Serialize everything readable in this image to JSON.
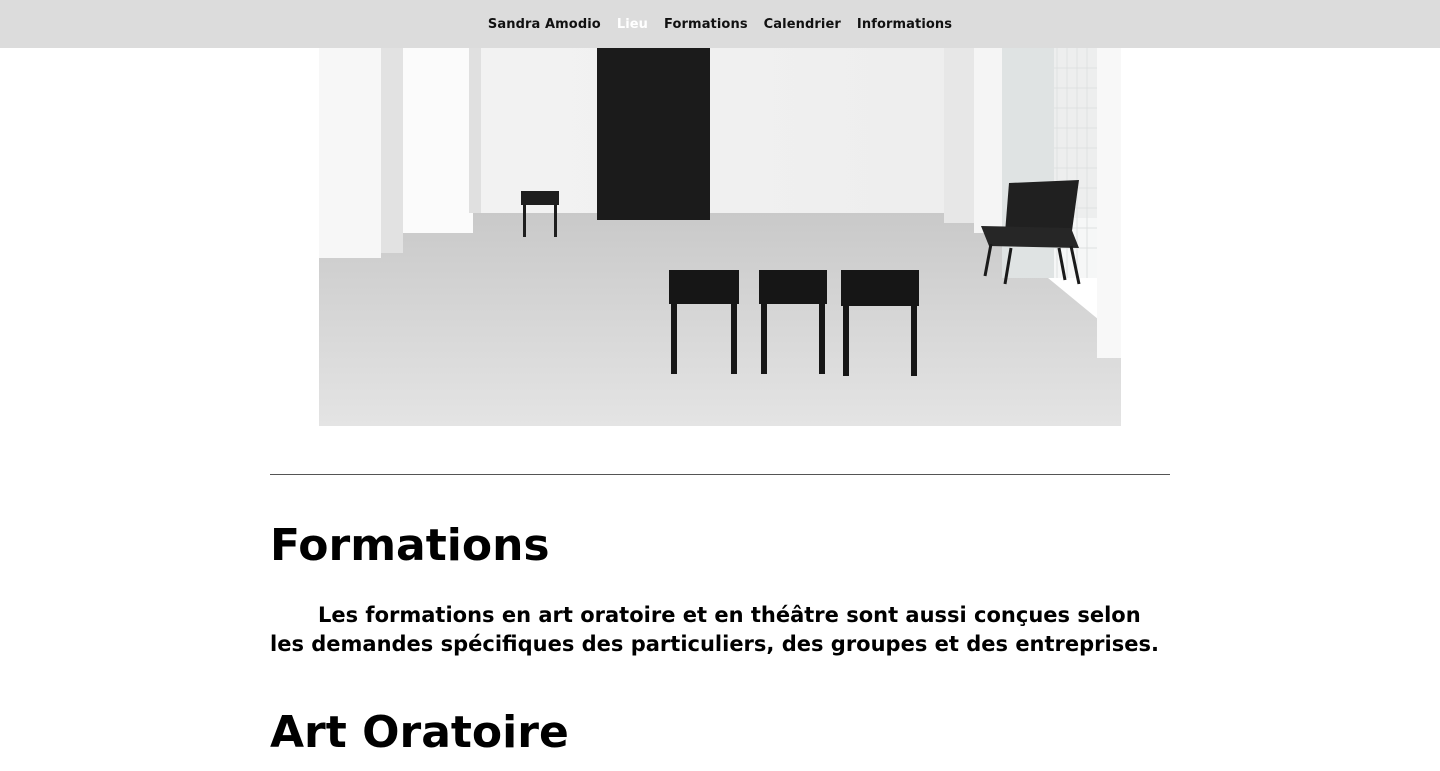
{
  "nav": {
    "items": [
      {
        "label": "Sandra Amodio",
        "active": false
      },
      {
        "label": "Lieu",
        "active": true
      },
      {
        "label": "Formations",
        "active": false
      },
      {
        "label": "Calendrier",
        "active": false
      },
      {
        "label": "Informations",
        "active": false
      }
    ]
  },
  "hero": {
    "description_icon": "gallery-room-photo"
  },
  "formations": {
    "title": "Formations",
    "intro": "Les formations en art oratoire et en théâtre sont aussi conçues selon les demandes spécifiques des particuliers, des groupes et des entreprises."
  },
  "art_oratoire": {
    "title": "Art Oratoire"
  },
  "colors": {
    "nav_bg": "#dcdcdc",
    "nav_active": "#ffffff",
    "text": "#000000",
    "rule": "#555555"
  }
}
